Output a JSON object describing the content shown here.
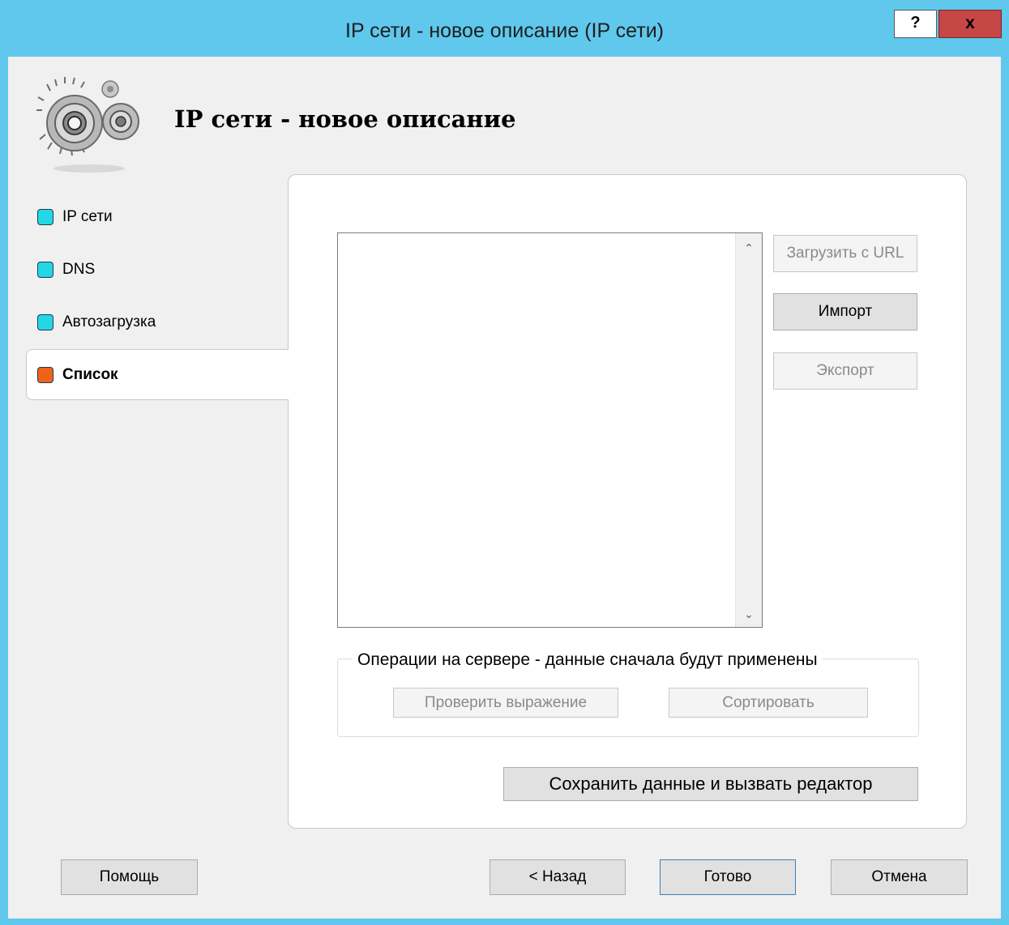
{
  "window": {
    "title": "IP сети - новое описание (IP сети)",
    "help_label": "?",
    "close_label": "x"
  },
  "header": {
    "title": "IP сети - новое описание"
  },
  "nav": {
    "items": [
      {
        "label": "IP сети",
        "color": "#22d8e8",
        "active": false
      },
      {
        "label": "DNS",
        "color": "#22d8e8",
        "active": false
      },
      {
        "label": "Автозагрузка",
        "color": "#22d8e8",
        "active": false
      },
      {
        "label": "Список",
        "color": "#f0621a",
        "active": true
      }
    ]
  },
  "list": {
    "side_buttons": {
      "load_url": "Загрузить с URL",
      "import": "Импорт",
      "export": "Экспорт"
    }
  },
  "server_ops": {
    "title": "Операции на сервере - данные сначала будут применены",
    "check_label": "Проверить выражение",
    "sort_label": "Сортировать"
  },
  "save_editor_label": "Сохранить данные и вызвать редактор",
  "footer": {
    "help": "Помощь",
    "back": "< Назад",
    "done": "Готово",
    "cancel": "Отмена"
  }
}
